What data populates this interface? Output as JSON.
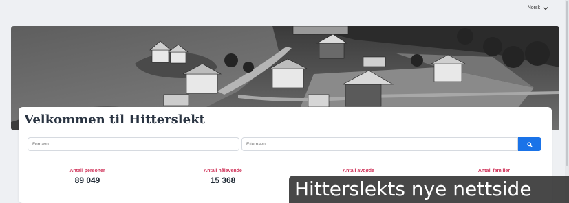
{
  "header": {
    "language_label": "Norsk",
    "language_icon": "chevron-down-icon"
  },
  "hero": {
    "image": "black-and-white aerial photo of coastal farmstead with houses by the sea"
  },
  "main": {
    "title": "Velkommen til Hitterslekt",
    "search": {
      "firstname_placeholder": "Fornavn",
      "lastname_placeholder": "Etternavn",
      "button_icon": "search-icon",
      "button_color": "#1a73e8"
    },
    "stats": [
      {
        "label": "Antall personer",
        "value": "89 049"
      },
      {
        "label": "Antall nålevende",
        "value": "15 368"
      },
      {
        "label": "Antall avdøde",
        "value": ""
      },
      {
        "label": "Antall familier",
        "value": ""
      }
    ],
    "stat_label_color": "#d0345a"
  },
  "overlay": {
    "text": "Hitterslekts nye nettside"
  }
}
